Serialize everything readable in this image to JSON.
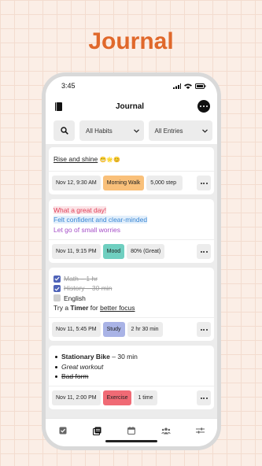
{
  "headline": "Journal",
  "status": {
    "time": "3:45"
  },
  "appbar": {
    "title": "Journal"
  },
  "filters": {
    "habits": "All Habits",
    "entries": "All Entries"
  },
  "colors": {
    "accent": "#e0682b",
    "morning_walk": "#f9c07a",
    "mood": "#6fcfc0",
    "study": "#a9b3e6",
    "exercise": "#f06a75"
  },
  "entries": [
    {
      "text_prefix": "Rise and shine",
      "emoji": "😬🌟😊",
      "date": "Nov 12, 9:30 AM",
      "habit": "Morning Walk",
      "value": "5,000 step"
    },
    {
      "lines": [
        "What a great day!",
        "Felt confident and clear-minded",
        "Let go of small worries"
      ],
      "date": "Nov 11, 9:15 PM",
      "habit": "Mood",
      "value": "80% (Great)"
    },
    {
      "tasks": [
        {
          "text": "Math – 1 hr",
          "checked": true
        },
        {
          "text": "History – 30 min",
          "checked": true
        },
        {
          "text": "English",
          "checked": false
        }
      ],
      "tip_pre": "Try a",
      "tip_bold": "Timer",
      "tip_mid": "for",
      "tip_link": "better focus",
      "date": "Nov 11, 5:45 PM",
      "habit": "Study",
      "value": "2 hr 30 min"
    },
    {
      "bullet1_bold": "Stationary Bike",
      "bullet1_rest": "– 30 min",
      "bullet2": "Great workout",
      "bullet3": "Bad form",
      "date": "Nov 11, 2:00 PM",
      "habit": "Exercise",
      "value": "1 time"
    }
  ],
  "tabs": [
    "checklist-icon",
    "journal-icon",
    "calendar-icon",
    "people-icon",
    "settings-sliders-icon"
  ]
}
